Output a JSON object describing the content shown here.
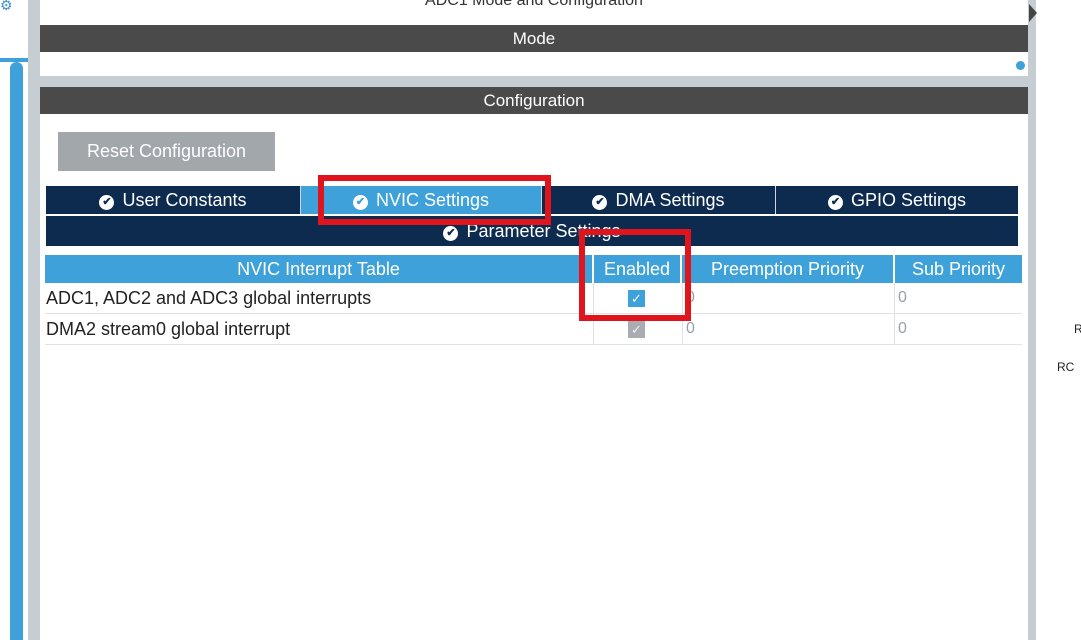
{
  "panel": {
    "top_title": "ADC1 Mode and Configuration",
    "mode_header": "Mode",
    "config_header": "Configuration"
  },
  "reset_button": "Reset Configuration",
  "tabs": [
    {
      "label": "User Constants",
      "active": false
    },
    {
      "label": "NVIC Settings",
      "active": true
    },
    {
      "label": "DMA Settings",
      "active": false
    },
    {
      "label": "GPIO Settings",
      "active": false
    }
  ],
  "parameter_tab": {
    "label": "Parameter Settings"
  },
  "nvic_table": {
    "columns": [
      "NVIC Interrupt Table",
      "Enabled",
      "Preemption Priority",
      "Sub Priority"
    ],
    "rows": [
      {
        "name": "ADC1, ADC2 and ADC3 global interrupts",
        "enabled": true,
        "editable": true,
        "preemption": "0",
        "sub": "0"
      },
      {
        "name": "DMA2 stream0 global interrupt",
        "enabled": true,
        "editable": false,
        "preemption": "0",
        "sub": "0"
      }
    ]
  },
  "icons": {
    "check": "✓",
    "tab_check": "✔",
    "gear": "⚙"
  },
  "right_edge": {
    "text_1": "R",
    "text_2": "RC"
  },
  "colors": {
    "accent_blue": "#3ea1d9",
    "tab_navy": "#0c2b4f",
    "header_gray": "#4a4a4a",
    "highlight_red": "#e0141c"
  }
}
